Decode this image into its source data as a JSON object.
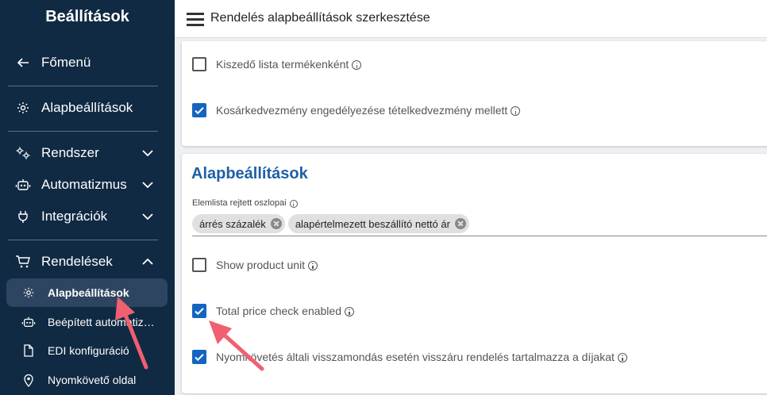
{
  "sidebar": {
    "title": "Beállítások",
    "items": [
      {
        "label": "Főmenü",
        "icon": "arrow-left-icon"
      },
      {
        "label": "Alapbeállítások",
        "icon": "gear-icon"
      },
      {
        "label": "Rendszer",
        "icon": "gears-icon"
      },
      {
        "label": "Automatizmus",
        "icon": "robot-icon"
      },
      {
        "label": "Integrációk",
        "icon": "plug-icon"
      },
      {
        "label": "Rendelések",
        "icon": "cart-icon"
      }
    ],
    "subitems": [
      {
        "label": "Alapbeállítások",
        "icon": "gear-icon",
        "active": true
      },
      {
        "label": "Beépített automatizmusok",
        "icon": "robot-icon"
      },
      {
        "label": "EDI konfiguráció",
        "icon": "file-icon"
      },
      {
        "label": "Nyomkövető oldal",
        "icon": "location-pin-icon"
      }
    ]
  },
  "header": {
    "title": "Rendelés alapbeállítások szerkesztése"
  },
  "card1": {
    "options": [
      {
        "label": "Kiszedő lista termékenként",
        "checked": false
      },
      {
        "label": "Kosárkedvezmény engedélyezése tételkedvezmény mellett",
        "checked": true
      }
    ]
  },
  "card2": {
    "title": "Alapbeállítások",
    "field_label": "Elemlista rejtett oszlopai",
    "chips": [
      "árrés százalék",
      "alapértelmezett beszállító nettó ár"
    ],
    "options": [
      {
        "label": "Show product unit",
        "checked": false
      },
      {
        "label": "Total price check enabled",
        "checked": true
      },
      {
        "label": "Nyomkövetés általi visszamondás esetén visszáru rendelés tartalmazza a díjakat",
        "checked": true
      }
    ]
  },
  "colors": {
    "sidebar_bg": "#102a43",
    "accent": "#1565c0",
    "title_blue": "#1f5fa6",
    "arrow": "#f06070"
  }
}
